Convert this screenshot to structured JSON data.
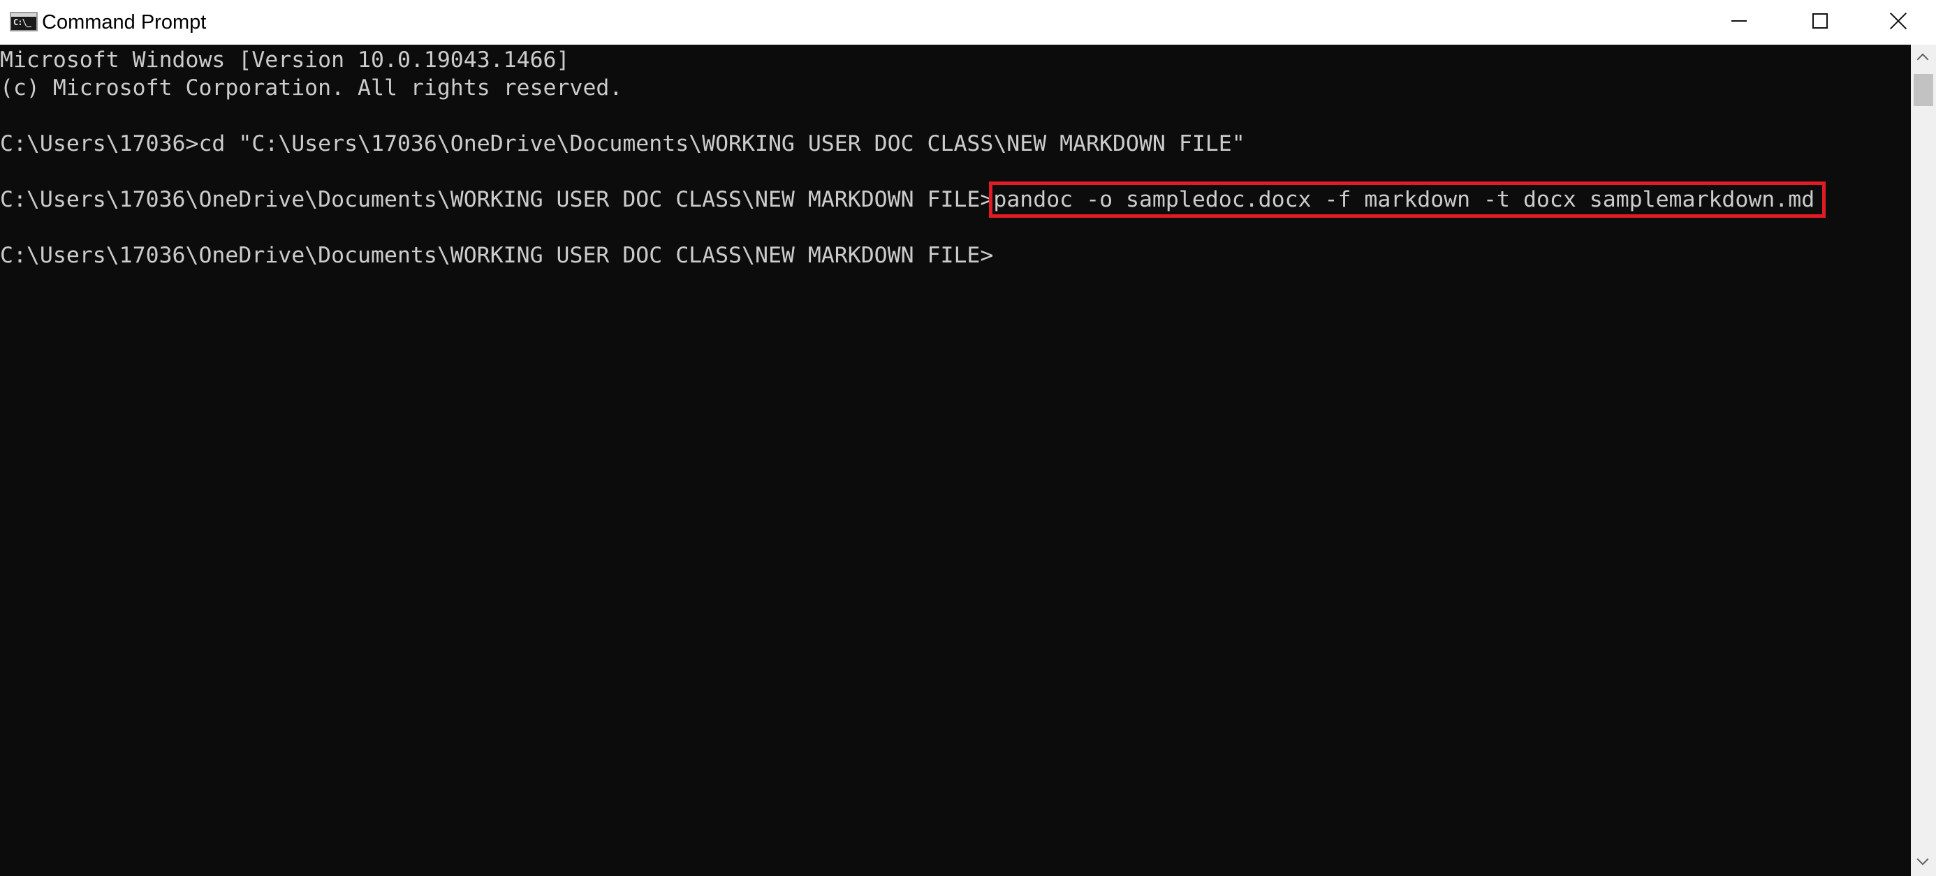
{
  "window": {
    "title": "Command Prompt",
    "icon": "cmd-icon",
    "icon_glyph": "C:\\_"
  },
  "controls": {
    "minimize_icon": "minimize-icon",
    "maximize_icon": "maximize-icon",
    "close_icon": "close-icon"
  },
  "console": {
    "lines": [
      "Microsoft Windows [Version 10.0.19043.1466]",
      "(c) Microsoft Corporation. All rights reserved.",
      "C:\\Users\\17036>cd \"C:\\Users\\17036\\OneDrive\\Documents\\WORKING USER DOC CLASS\\NEW MARKDOWN FILE\"",
      "C:\\Users\\17036\\OneDrive\\Documents\\WORKING USER DOC CLASS\\NEW MARKDOWN FILE>",
      "C:\\Users\\17036\\OneDrive\\Documents\\WORKING USER DOC CLASS\\NEW MARKDOWN FILE>"
    ],
    "highlighted_command": "pandoc -o sampledoc.docx -f markdown -t docx samplemarkdown.md",
    "highlight_color": "#e01b24",
    "background_color": "#0c0c0c",
    "text_color": "#cccccc"
  }
}
